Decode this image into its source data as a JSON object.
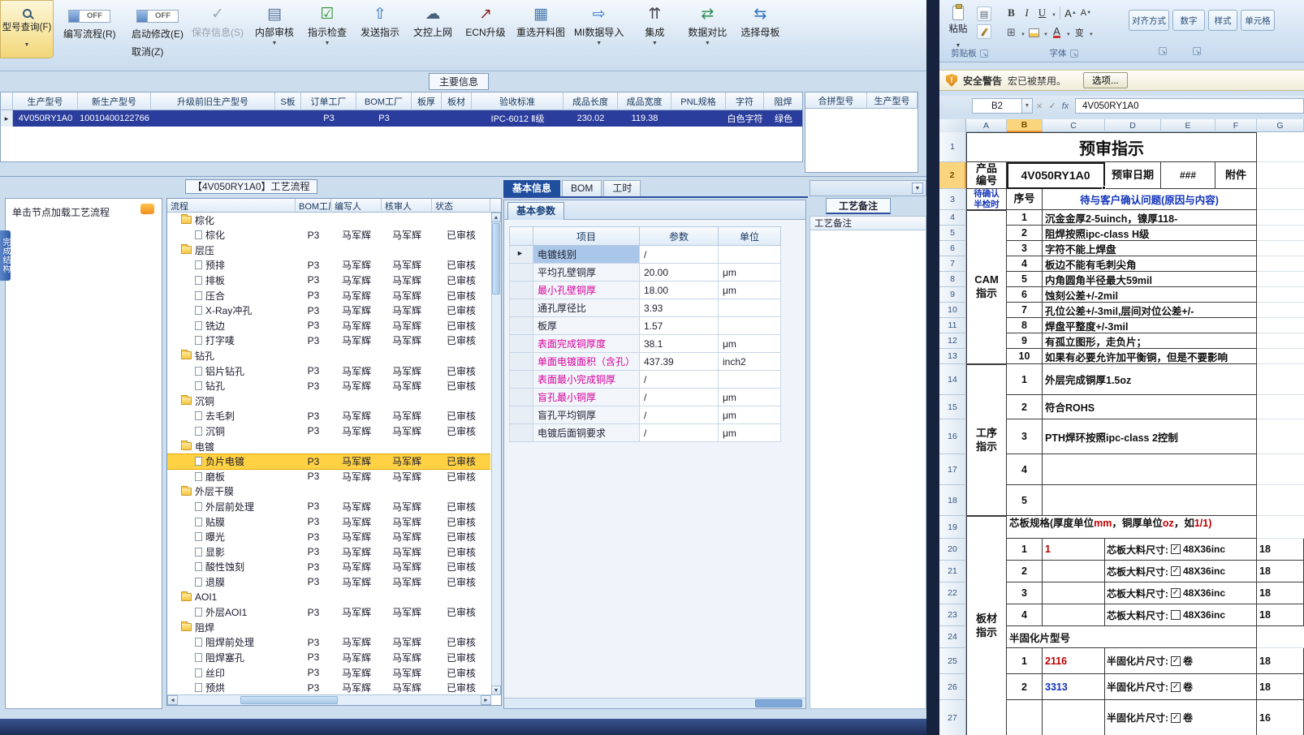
{
  "app": {
    "toolbar": {
      "query_button": {
        "label": "型号查询(F)"
      },
      "toggle1": {
        "state": "OFF",
        "label": "编写流程(R)"
      },
      "toggle2": {
        "state": "OFF",
        "label": "启动修改(E)",
        "label2": "取消(Z)"
      },
      "buttons": [
        {
          "label": "保存信息(S)",
          "icon": "save-check-icon",
          "dropdown": false,
          "disabled": true
        },
        {
          "label": "内部审核",
          "icon": "printer-icon",
          "dropdown": true,
          "disabled": false
        },
        {
          "label": "指示检查",
          "icon": "inspect-check-icon",
          "dropdown": true,
          "disabled": false
        },
        {
          "label": "发送指示",
          "icon": "send-up-icon",
          "dropdown": false,
          "disabled": false
        },
        {
          "label": "文控上网",
          "icon": "cloud-upload-icon",
          "dropdown": false,
          "disabled": false
        },
        {
          "label": "ECN升级",
          "icon": "ecn-upgrade-icon",
          "dropdown": false,
          "disabled": false
        },
        {
          "label": "重选开料图",
          "icon": "reselect-image-icon",
          "dropdown": false,
          "disabled": false
        },
        {
          "label": "MI数据导入",
          "icon": "mi-import-icon",
          "dropdown": true,
          "disabled": false
        },
        {
          "label": "集成",
          "icon": "integrate-icon",
          "dropdown": true,
          "disabled": false
        },
        {
          "label": "数据对比",
          "icon": "data-compare-icon",
          "dropdown": true,
          "disabled": false
        },
        {
          "label": "选择母板",
          "icon": "select-board-icon",
          "dropdown": false,
          "disabled": false
        }
      ]
    },
    "main_info": {
      "title": "主要信息",
      "columns": [
        "生产型号",
        "新生产型号",
        "升级前旧生产型号",
        "S板",
        "订单工厂",
        "BOM工厂",
        "板厚",
        "板材",
        "验收标准",
        "成品长度",
        "成品宽度",
        "PNL规格",
        "字符",
        "阻焊"
      ],
      "row": [
        "4V050RY1A0",
        "10010400122766",
        "",
        "",
        "P3",
        "P3",
        "",
        "",
        "IPC-6012 Ⅱ级",
        "230.02",
        "119.38",
        "",
        "白色字符",
        "绿色"
      ],
      "right_columns": [
        "合拼型号",
        "生产型号"
      ]
    },
    "left_panel": {
      "hint": "单击节点加载工艺流程",
      "vertical_tab": "完成结构"
    },
    "flow": {
      "title": "【4V050RY1A0】工艺流程",
      "columns": [
        "流程",
        "BOM工厂",
        "编写人",
        "核审人",
        "状态"
      ],
      "item_defaults": {
        "bom": "P3",
        "writer": "马军辉",
        "auditor": "马军辉",
        "status": "已审核"
      },
      "rows": [
        {
          "type": "folder",
          "name": "棕化"
        },
        {
          "type": "item",
          "name": "棕化"
        },
        {
          "type": "folder",
          "name": "层压"
        },
        {
          "type": "item",
          "name": "预排"
        },
        {
          "type": "item",
          "name": "排板"
        },
        {
          "type": "item",
          "name": "压合"
        },
        {
          "type": "item",
          "name": "X-Ray冲孔"
        },
        {
          "type": "item",
          "name": "铣边"
        },
        {
          "type": "item",
          "name": "打字唛"
        },
        {
          "type": "folder",
          "name": "钻孔"
        },
        {
          "type": "item",
          "name": "铝片钻孔"
        },
        {
          "type": "item",
          "name": "钻孔"
        },
        {
          "type": "folder",
          "name": "沉铜"
        },
        {
          "type": "item",
          "name": "去毛刺"
        },
        {
          "type": "item",
          "name": "沉铜"
        },
        {
          "type": "folder",
          "name": "电镀"
        },
        {
          "type": "item",
          "name": "负片电镀",
          "highlight": true
        },
        {
          "type": "item",
          "name": "磨板"
        },
        {
          "type": "folder",
          "name": "外层干膜"
        },
        {
          "type": "item",
          "name": "外层前处理"
        },
        {
          "type": "item",
          "name": "贴膜"
        },
        {
          "type": "item",
          "name": "曝光"
        },
        {
          "type": "item",
          "name": "显影"
        },
        {
          "type": "item",
          "name": "酸性蚀刻"
        },
        {
          "type": "item",
          "name": "退膜"
        },
        {
          "type": "folder",
          "name": "AOI1"
        },
        {
          "type": "item",
          "name": "外层AOI1"
        },
        {
          "type": "folder",
          "name": "阻焊"
        },
        {
          "type": "item",
          "name": "阻焊前处理"
        },
        {
          "type": "item",
          "name": "阻焊塞孔"
        },
        {
          "type": "item",
          "name": "丝印"
        },
        {
          "type": "item",
          "name": "预烘"
        }
      ]
    },
    "detail": {
      "tabs": [
        "基本信息",
        "BOM",
        "工时"
      ],
      "active_tab": "基本信息",
      "subtab": "基本参数",
      "param_columns": [
        "项目",
        "参数",
        "单位"
      ],
      "params": [
        {
          "name": "电镀线别",
          "value": "/",
          "unit": "",
          "pink": false,
          "selected": true
        },
        {
          "name": "平均孔壁铜厚",
          "value": "20.00",
          "unit": "μm",
          "pink": false
        },
        {
          "name": "最小孔壁铜厚",
          "value": "18.00",
          "unit": "μm",
          "pink": true
        },
        {
          "name": "通孔厚径比",
          "value": "3.93",
          "unit": "",
          "pink": false
        },
        {
          "name": "板厚",
          "value": "1.57",
          "unit": "",
          "pink": false
        },
        {
          "name": "表面完成铜厚度",
          "value": "38.1",
          "unit": "μm",
          "pink": true
        },
        {
          "name": "单面电镀面积（含孔）",
          "value": "437.39",
          "unit": "inch2",
          "pink": true
        },
        {
          "name": "表面最小完成铜厚",
          "value": "/",
          "unit": "",
          "pink": true
        },
        {
          "name": "盲孔最小铜厚",
          "value": "/",
          "unit": "μm",
          "pink": true
        },
        {
          "name": "盲孔平均铜厚",
          "value": "/",
          "unit": "μm",
          "pink": false
        },
        {
          "name": "电镀后面铜要求",
          "value": "/",
          "unit": "μm",
          "pink": false
        }
      ]
    },
    "notes_panel": {
      "tab": "工艺备注",
      "header": "工艺备注"
    }
  },
  "excel": {
    "ribbon": {
      "paste_label": "粘贴",
      "clipboard_group": "剪贴板",
      "font_group": "字体",
      "collapsed_groups": [
        "对齐方式",
        "数字",
        "样式",
        "单元格"
      ]
    },
    "security_bar": {
      "label": "安全警告",
      "message": "宏已被禁用。",
      "options_button": "选项..."
    },
    "formula_bar": {
      "name_box": "B2",
      "value": "4V050RY1A0"
    },
    "columns": [
      "A",
      "B",
      "C",
      "D",
      "E",
      "F",
      "G"
    ],
    "sections": [
      {
        "label": "CAM\n指示",
        "from": 4,
        "to": 13
      },
      {
        "label": "工序\n指示",
        "from": 14,
        "to": 18
      },
      {
        "label": "板材\n指示",
        "from": 19,
        "to": 27
      }
    ],
    "rows": [
      {
        "n": 1,
        "cells": [
          {
            "c": "A",
            "to": "F",
            "t": "预审指示",
            "s": "title"
          }
        ]
      },
      {
        "n": 2,
        "cells": [
          {
            "c": "A",
            "t": "产品\n编号",
            "s": "hdr"
          },
          {
            "c": "B",
            "to": "C",
            "t": "4V050RY1A0",
            "s": "bigval",
            "selected": true
          },
          {
            "c": "D",
            "t": "预审日期",
            "s": "hdr"
          },
          {
            "c": "E",
            "t": "###",
            "s": "hash"
          },
          {
            "c": "F",
            "t": "附件",
            "s": "hdr"
          }
        ]
      },
      {
        "n": 3,
        "cells": [
          {
            "c": "A",
            "t": "待确认\n半检时",
            "s": "asmall"
          },
          {
            "c": "B",
            "t": "序号",
            "s": "hdr"
          },
          {
            "c": "C",
            "to": "F",
            "t": "待与客户确认问题(原因与内容)",
            "s": "bluehdr"
          }
        ]
      },
      {
        "n": 4,
        "cells": [
          {
            "c": "B",
            "t": "1",
            "s": "num"
          },
          {
            "c": "C",
            "to": "F",
            "t": "沉金金厚2-5uinch，镍厚118-",
            "s": "txt"
          }
        ]
      },
      {
        "n": 5,
        "cells": [
          {
            "c": "B",
            "t": "2",
            "s": "num"
          },
          {
            "c": "C",
            "to": "F",
            "t": "阻焊按照ipc-class H级",
            "s": "txt"
          }
        ]
      },
      {
        "n": 6,
        "cells": [
          {
            "c": "B",
            "t": "3",
            "s": "num"
          },
          {
            "c": "C",
            "to": "F",
            "t": "字符不能上焊盘",
            "s": "txt"
          }
        ]
      },
      {
        "n": 7,
        "cells": [
          {
            "c": "B",
            "t": "4",
            "s": "num"
          },
          {
            "c": "C",
            "to": "F",
            "t": "板边不能有毛刺尖角",
            "s": "txt"
          }
        ]
      },
      {
        "n": 8,
        "cells": [
          {
            "c": "B",
            "t": "5",
            "s": "num"
          },
          {
            "c": "C",
            "to": "F",
            "t": "内角圆角半径最大59mil",
            "s": "txt"
          }
        ]
      },
      {
        "n": 9,
        "cells": [
          {
            "c": "B",
            "t": "6",
            "s": "num"
          },
          {
            "c": "C",
            "to": "F",
            "t": "蚀刻公差+/-2mil",
            "s": "txt"
          }
        ]
      },
      {
        "n": 10,
        "cells": [
          {
            "c": "B",
            "t": "7",
            "s": "num"
          },
          {
            "c": "C",
            "to": "F",
            "t": "孔位公差+/-3mil,层间对位公差+/-",
            "s": "txt"
          }
        ]
      },
      {
        "n": 11,
        "cells": [
          {
            "c": "B",
            "t": "8",
            "s": "num"
          },
          {
            "c": "C",
            "to": "F",
            "t": "焊盘平整度+/-3mil",
            "s": "txt"
          }
        ]
      },
      {
        "n": 12,
        "cells": [
          {
            "c": "B",
            "t": "9",
            "s": "num"
          },
          {
            "c": "C",
            "to": "F",
            "t": "有孤立图形，走负片；",
            "s": "txt"
          }
        ]
      },
      {
        "n": 13,
        "cells": [
          {
            "c": "B",
            "t": "10",
            "s": "num"
          },
          {
            "c": "C",
            "to": "F",
            "t": "如果有必要允许加平衡铜，但是不要影响",
            "s": "txt"
          }
        ]
      },
      {
        "n": 14,
        "cells": [
          {
            "c": "B",
            "t": "1",
            "s": "num"
          },
          {
            "c": "C",
            "to": "F",
            "t": "外层完成铜厚1.5oz",
            "s": "txt"
          }
        ]
      },
      {
        "n": 15,
        "cells": [
          {
            "c": "B",
            "t": "2",
            "s": "num"
          },
          {
            "c": "C",
            "to": "F",
            "t": "符合ROHS",
            "s": "txt"
          }
        ]
      },
      {
        "n": 16,
        "cells": [
          {
            "c": "B",
            "t": "3",
            "s": "num"
          },
          {
            "c": "C",
            "to": "F",
            "t": "PTH焊环按照ipc-class 2控制",
            "s": "txt"
          }
        ]
      },
      {
        "n": 17,
        "cells": [
          {
            "c": "B",
            "t": "4",
            "s": "num"
          },
          {
            "c": "C",
            "to": "F",
            "t": "",
            "s": "txt"
          }
        ]
      },
      {
        "n": 18,
        "cells": [
          {
            "c": "B",
            "t": "5",
            "s": "num"
          },
          {
            "c": "C",
            "to": "F",
            "t": "",
            "s": "txt"
          }
        ]
      },
      {
        "n": 19,
        "cells": [
          {
            "c": "B",
            "to": "F",
            "s": "txt",
            "seg": [
              {
                "t": "芯板规格(厚度单位"
              },
              {
                "t": "mm",
                "red": true
              },
              {
                "t": "，铜厚单位"
              },
              {
                "t": "oz",
                "red": true
              },
              {
                "t": "，如 "
              },
              {
                "t": "1/1)",
                "red": true
              }
            ]
          }
        ]
      },
      {
        "n": 20,
        "cells": [
          {
            "c": "B",
            "t": "1",
            "s": "num"
          },
          {
            "c": "C",
            "t": "1",
            "s": "redval"
          },
          {
            "c": "D",
            "to": "F",
            "t": "芯板大料尺寸:",
            "s": "chk",
            "checkbox": true,
            "checked": true,
            "after": "48X36inc"
          },
          {
            "c": "G",
            "t": "18",
            "s": "txt"
          }
        ]
      },
      {
        "n": 21,
        "cells": [
          {
            "c": "B",
            "t": "2",
            "s": "num"
          },
          {
            "c": "C",
            "t": "",
            "s": "txt"
          },
          {
            "c": "D",
            "to": "F",
            "t": "芯板大料尺寸:",
            "s": "chk",
            "checkbox": true,
            "checked": true,
            "after": "48X36inc"
          },
          {
            "c": "G",
            "t": "18",
            "s": "txt"
          }
        ]
      },
      {
        "n": 22,
        "cells": [
          {
            "c": "B",
            "t": "3",
            "s": "num"
          },
          {
            "c": "C",
            "t": "",
            "s": "txt"
          },
          {
            "c": "D",
            "to": "F",
            "t": "芯板大料尺寸:",
            "s": "chk",
            "checkbox": true,
            "checked": true,
            "after": "48X36inc"
          },
          {
            "c": "G",
            "t": "18",
            "s": "txt"
          }
        ]
      },
      {
        "n": 23,
        "cells": [
          {
            "c": "B",
            "t": "4",
            "s": "num"
          },
          {
            "c": "C",
            "t": "",
            "s": "txt"
          },
          {
            "c": "D",
            "to": "F",
            "t": "芯板大料尺寸:",
            "s": "chk",
            "checkbox": true,
            "checked": false,
            "after": "48X36inc"
          },
          {
            "c": "G",
            "t": "18",
            "s": "txt"
          }
        ]
      },
      {
        "n": 24,
        "cells": [
          {
            "c": "B",
            "to": "F",
            "t": "半固化片型号",
            "s": "txt"
          }
        ]
      },
      {
        "n": 25,
        "cells": [
          {
            "c": "B",
            "t": "1",
            "s": "num"
          },
          {
            "c": "C",
            "t": "2116",
            "s": "redval"
          },
          {
            "c": "D",
            "to": "F",
            "t": "半固化片尺寸:",
            "s": "chk",
            "checkbox": true,
            "checked": true,
            "after": "卷"
          },
          {
            "c": "G",
            "t": "18",
            "s": "txt"
          }
        ]
      },
      {
        "n": 26,
        "cells": [
          {
            "c": "B",
            "t": "2",
            "s": "num"
          },
          {
            "c": "C",
            "t": "3313",
            "s": "blueval"
          },
          {
            "c": "D",
            "to": "F",
            "t": "半固化片尺寸:",
            "s": "chk",
            "checkbox": true,
            "checked": true,
            "after": "卷"
          },
          {
            "c": "G",
            "t": "18",
            "s": "txt"
          }
        ]
      },
      {
        "n": 27,
        "cells": [
          {
            "c": "B",
            "t": "",
            "s": "num"
          },
          {
            "c": "C",
            "t": "",
            "s": "txt"
          },
          {
            "c": "D",
            "to": "F",
            "t": "半固化片尺寸:",
            "s": "chk",
            "checkbox": true,
            "checked": true,
            "after": "卷"
          },
          {
            "c": "G",
            "t": "16",
            "s": "txt"
          }
        ]
      }
    ]
  }
}
